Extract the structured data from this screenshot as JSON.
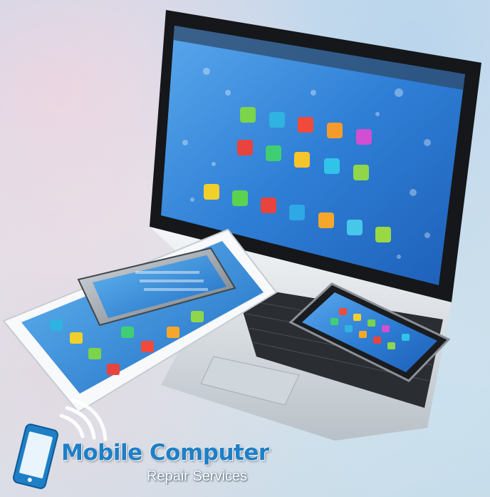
{
  "logo": {
    "title": "Mobile Computer",
    "subtitle": "Repair Services",
    "brand_color": "#1e7fc6"
  },
  "scene": {
    "devices": [
      "laptop",
      "tablet",
      "smartphone",
      "smartphone"
    ],
    "icon": "phone-signal-icon"
  }
}
